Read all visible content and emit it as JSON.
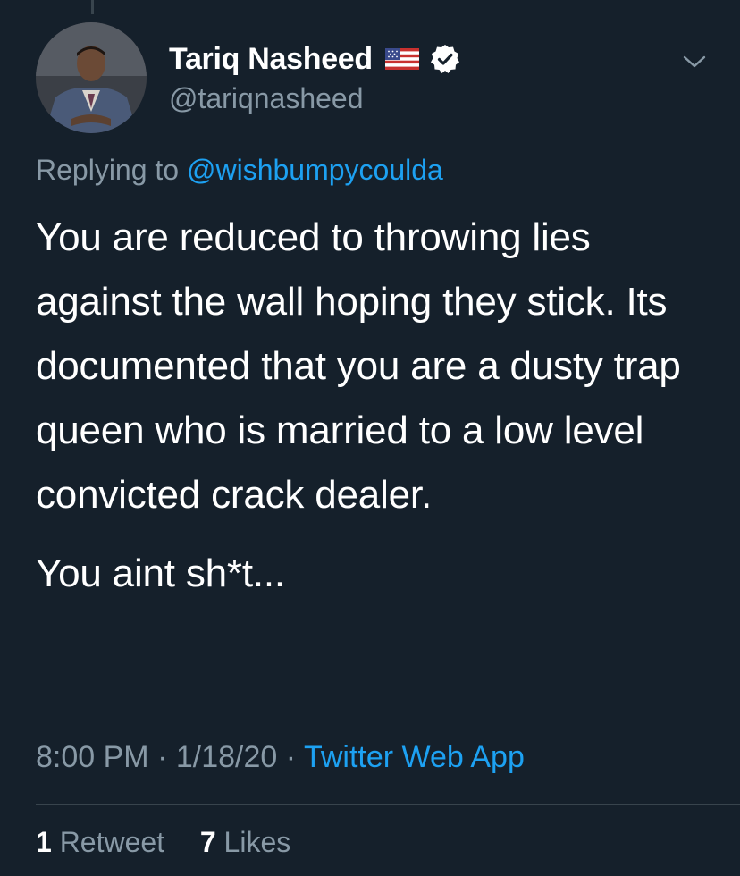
{
  "author": {
    "display_name": "Tariq Nasheed",
    "handle": "@tariqnasheed",
    "badges": [
      "us-flag-icon",
      "verified-icon"
    ]
  },
  "reply": {
    "prefix": "Replying to",
    "mention": "@wishbumpycoulda"
  },
  "tweet": {
    "paragraph_1": "You are reduced to throwing lies against the wall hoping they stick. Its documented that you are a dusty trap queen who is married to a low level convicted crack dealer.",
    "paragraph_2": "You aint sh*t..."
  },
  "meta": {
    "time": "8:00 PM",
    "separator": "·",
    "date": "1/18/20",
    "source": "Twitter Web App"
  },
  "stats": {
    "retweets_count": "1",
    "retweets_label": "Retweet",
    "likes_count": "7",
    "likes_label": "Likes"
  },
  "colors": {
    "background": "#15202b",
    "text_primary": "#ffffff",
    "text_secondary": "#8899a6",
    "link": "#1da1f2",
    "divider": "#38444d"
  },
  "icons": {
    "more": "chevron-down-icon",
    "avatar": "avatar"
  }
}
